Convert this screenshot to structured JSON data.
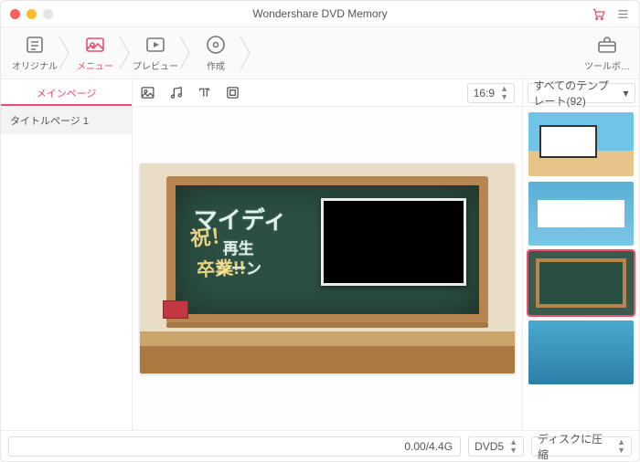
{
  "title": "Wondershare DVD Memory",
  "steps": {
    "original": "オリジナル",
    "menu": "メニュー",
    "preview": "プレビュー",
    "create": "作成",
    "tools": "ツールボ…"
  },
  "sidebar": {
    "tab": "メインページ",
    "item1": "タイトルページ 1"
  },
  "editbar": {
    "aspect": "16:9"
  },
  "preview": {
    "title": "マイディ",
    "play": "再生",
    "scene": "シーン",
    "deco1": "祝！",
    "deco2": "卒業!!"
  },
  "templates": {
    "header": "すべてのテンプレート(92)"
  },
  "footer": {
    "progress": "0.00/4.4G",
    "disc": "DVD5",
    "compress": "ディスクに圧縮"
  }
}
